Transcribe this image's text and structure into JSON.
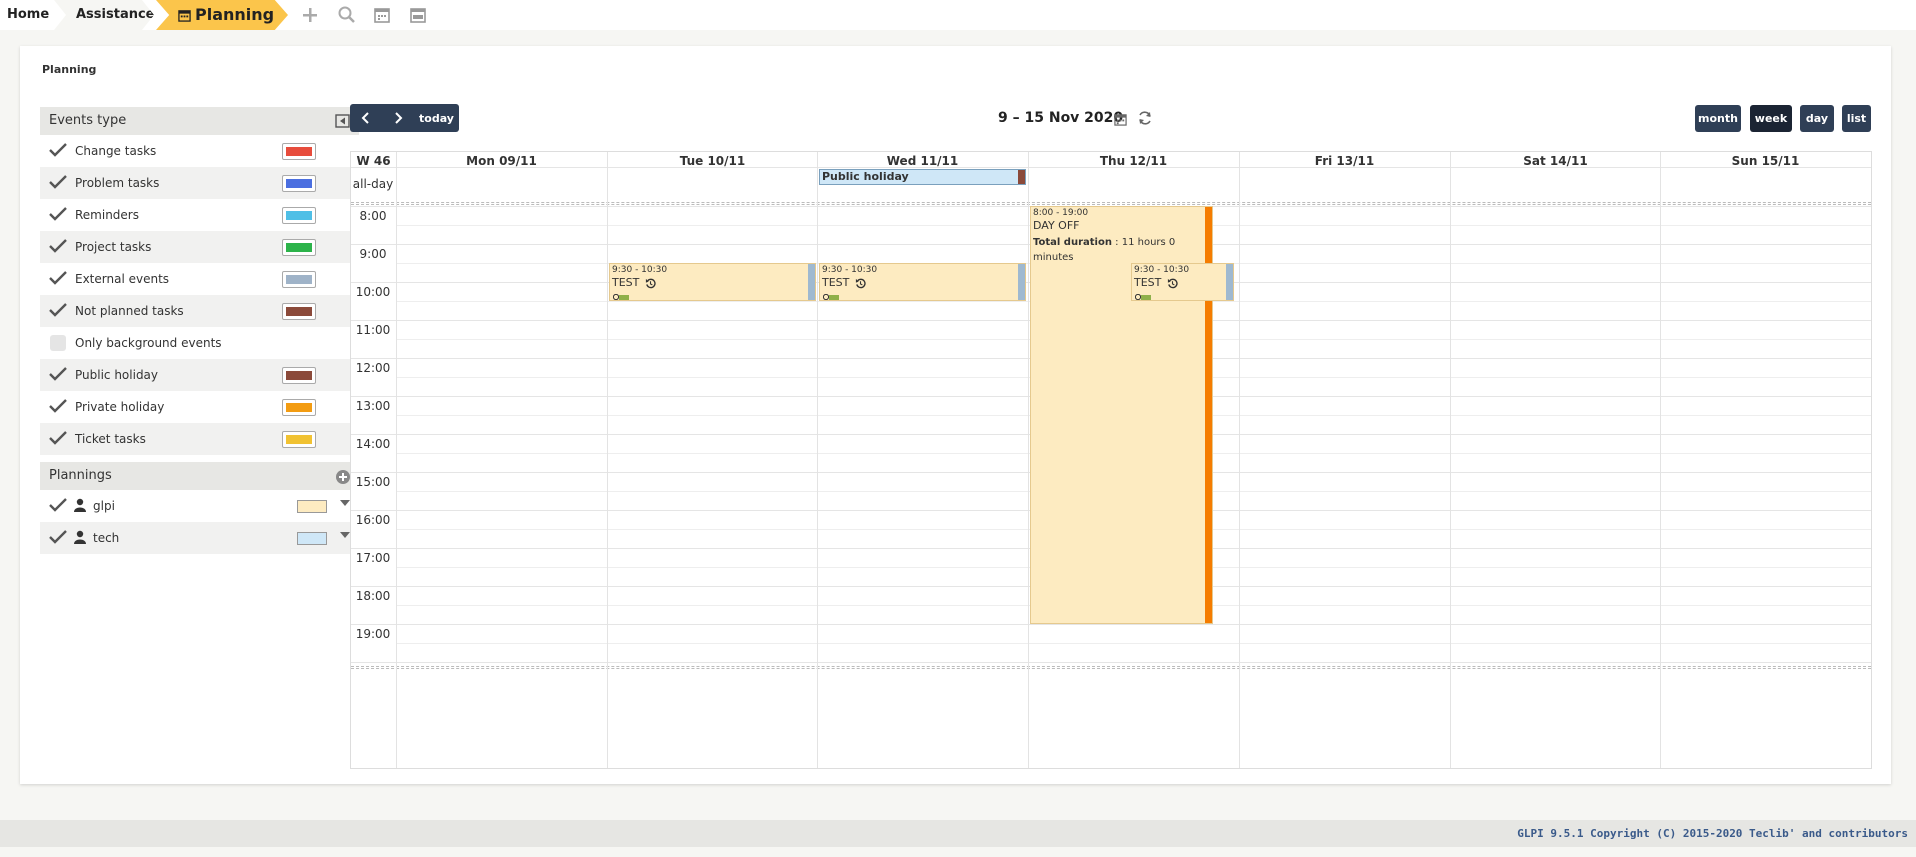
{
  "breadcrumb": {
    "home": "Home",
    "assistance": "Assistance",
    "planning": "Planning"
  },
  "panel_title": "Planning",
  "events_type": {
    "title": "Events type",
    "items": [
      {
        "label": "Change tasks",
        "checked": true,
        "color": "#e74c3c"
      },
      {
        "label": "Problem tasks",
        "checked": true,
        "color": "#4b6fe0"
      },
      {
        "label": "Reminders",
        "checked": true,
        "color": "#4fbfe6"
      },
      {
        "label": "Project tasks",
        "checked": true,
        "color": "#2cb34a"
      },
      {
        "label": "External events",
        "checked": true,
        "color": "#9fb3c8"
      },
      {
        "label": "Not planned tasks",
        "checked": true,
        "color": "#8b4a3a"
      },
      {
        "label": "Only background events",
        "checked": false,
        "color": ""
      },
      {
        "label": "Public holiday",
        "checked": true,
        "color": "#8b4a3a"
      },
      {
        "label": "Private holiday",
        "checked": true,
        "color": "#f39c12"
      },
      {
        "label": "Ticket tasks",
        "checked": true,
        "color": "#f1c232"
      }
    ]
  },
  "plannings": {
    "title": "Plannings",
    "items": [
      {
        "label": "glpi",
        "checked": true,
        "color": "#fdebc1"
      },
      {
        "label": "tech",
        "checked": true,
        "color": "#cfe7f7"
      }
    ]
  },
  "toolbar": {
    "today": "today",
    "range": "9 – 15 Nov 2020",
    "month": "month",
    "week": "week",
    "day": "day",
    "list": "list",
    "active_view": "week"
  },
  "calendar": {
    "week_label": "W 46",
    "allday_label": "all-day",
    "days": [
      "Mon 09/11",
      "Tue 10/11",
      "Wed 11/11",
      "Thu 12/11",
      "Fri 13/11",
      "Sat 14/11",
      "Sun 15/11"
    ],
    "hours": [
      "8:00",
      "9:00",
      "10:00",
      "11:00",
      "12:00",
      "13:00",
      "14:00",
      "15:00",
      "16:00",
      "17:00",
      "18:00",
      "19:00"
    ],
    "allday_event": {
      "title": "Public holiday",
      "day": "Wed 11/11"
    },
    "events": [
      {
        "time": "9:30 - 10:30",
        "title": "TEST",
        "day": "Tue 10/11"
      },
      {
        "time": "9:30 - 10:30",
        "title": "TEST",
        "day": "Wed 11/11"
      },
      {
        "time": "8:00 - 19:00",
        "title": "DAY OFF",
        "detail_label": "Total duration",
        "detail_value": ": 11 hours 0 minutes",
        "day": "Thu 12/11"
      },
      {
        "time": "9:30 - 10:30",
        "title": "TEST",
        "day": "Thu 12/11"
      }
    ]
  },
  "footer": "GLPI 9.5.1 Copyright (C) 2015-2020 Teclib' and contributors"
}
